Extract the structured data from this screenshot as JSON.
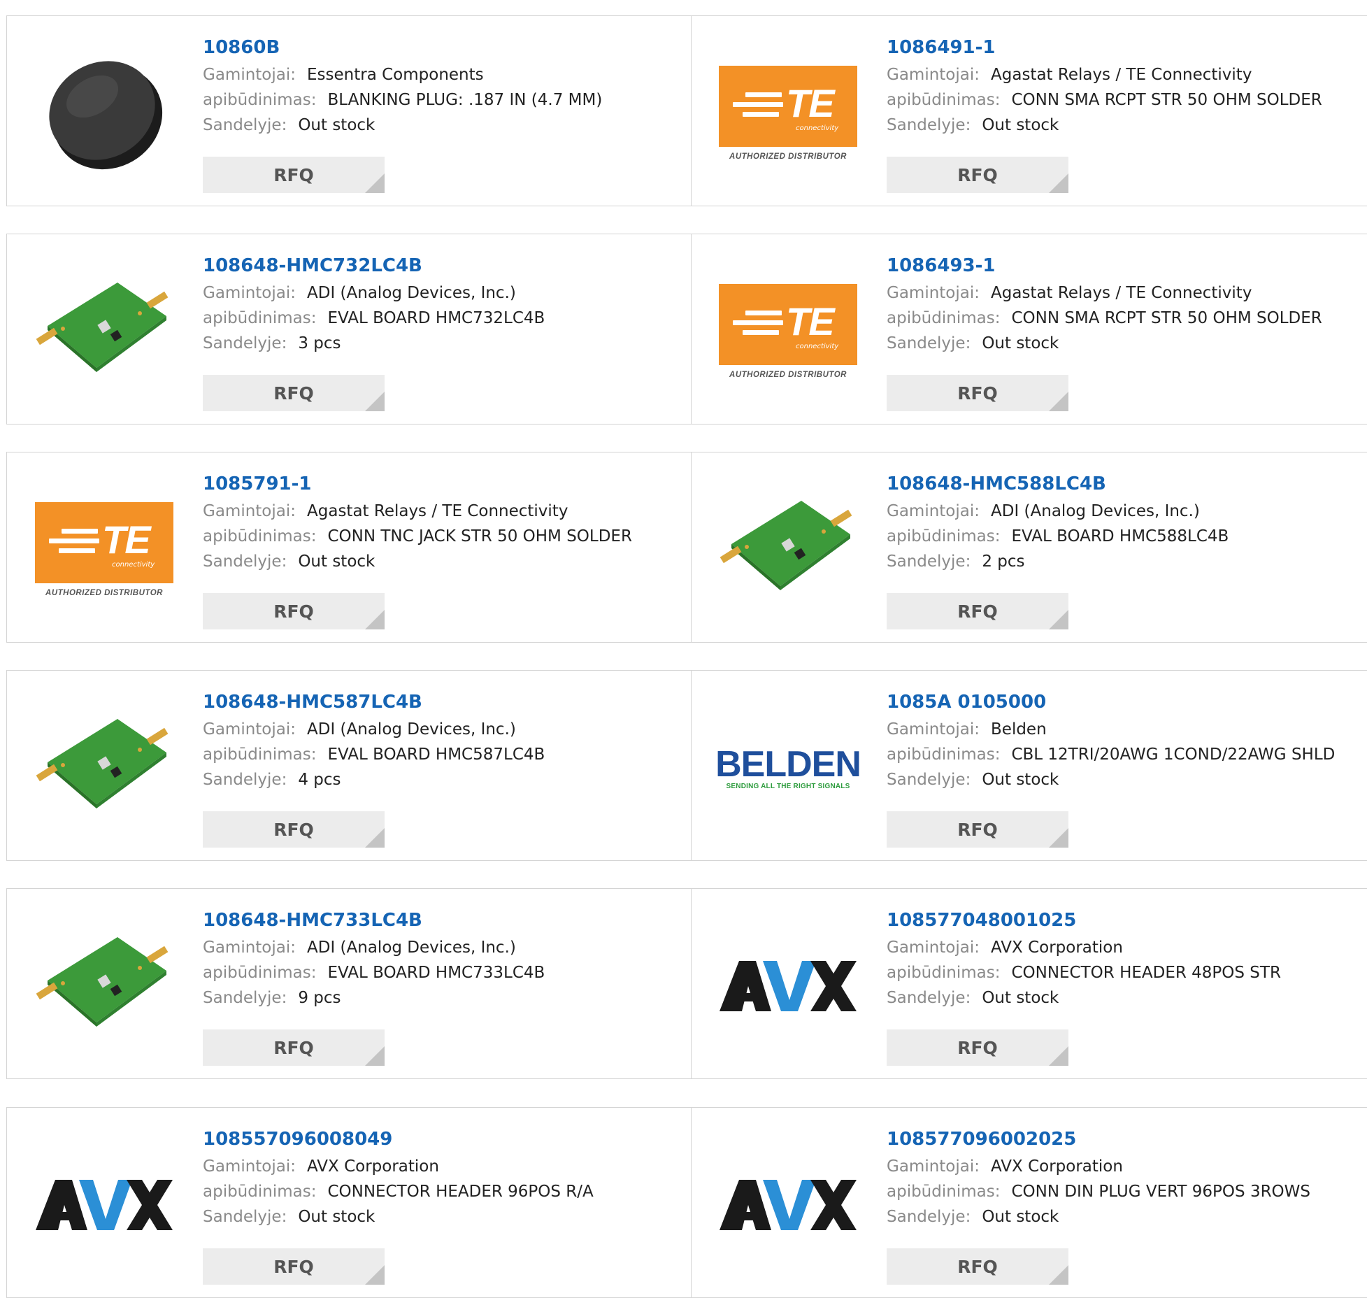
{
  "labels": {
    "manufacturer": "Gamintojai:",
    "description": "apibūdinimas:",
    "stock": "Sandelyje:",
    "rfq": "RFQ"
  },
  "logos": {
    "te_sub": "connectivity",
    "te_auth": "AUTHORIZED DISTRIBUTOR",
    "te_letters": "TE",
    "belden_name": "BELDEN",
    "belden_tag": "SENDING ALL THE RIGHT SIGNALS"
  },
  "products": [
    {
      "part": "10860B",
      "manufacturer": "Essentra Components",
      "description": "BLANKING PLUG: .187 IN (4.7 MM)",
      "stock": "Out stock",
      "image": "blanking-plug"
    },
    {
      "part": "1086491-1",
      "manufacturer": "Agastat Relays / TE Connectivity",
      "description": "CONN SMA RCPT STR 50 OHM SOLDER",
      "stock": "Out stock",
      "image": "te-logo"
    },
    {
      "part": "108648-HMC732LC4B",
      "manufacturer": "ADI (Analog Devices, Inc.)",
      "description": "EVAL BOARD HMC732LC4B",
      "stock": "3 pcs",
      "image": "eval-board"
    },
    {
      "part": "1086493-1",
      "manufacturer": "Agastat Relays / TE Connectivity",
      "description": "CONN SMA RCPT STR 50 OHM SOLDER",
      "stock": "Out stock",
      "image": "te-logo"
    },
    {
      "part": "1085791-1",
      "manufacturer": "Agastat Relays / TE Connectivity",
      "description": "CONN TNC JACK STR 50 OHM SOLDER",
      "stock": "Out stock",
      "image": "te-logo"
    },
    {
      "part": "108648-HMC588LC4B",
      "manufacturer": "ADI (Analog Devices, Inc.)",
      "description": "EVAL BOARD HMC588LC4B",
      "stock": "2 pcs",
      "image": "eval-board"
    },
    {
      "part": "108648-HMC587LC4B",
      "manufacturer": "ADI (Analog Devices, Inc.)",
      "description": "EVAL BOARD HMC587LC4B",
      "stock": "4 pcs",
      "image": "eval-board"
    },
    {
      "part": "1085A 0105000",
      "manufacturer": "Belden",
      "description": "CBL 12TRI/20AWG 1COND/22AWG SHLD",
      "stock": "Out stock",
      "image": "belden-logo"
    },
    {
      "part": "108648-HMC733LC4B",
      "manufacturer": "ADI (Analog Devices, Inc.)",
      "description": "EVAL BOARD HMC733LC4B",
      "stock": "9 pcs",
      "image": "eval-board"
    },
    {
      "part": "108577048001025",
      "manufacturer": "AVX Corporation",
      "description": "CONNECTOR HEADER 48POS STR",
      "stock": "Out stock",
      "image": "avx-logo"
    },
    {
      "part": "108557096008049",
      "manufacturer": "AVX Corporation",
      "description": "CONNECTOR HEADER 96POS R/A",
      "stock": "Out stock",
      "image": "avx-logo"
    },
    {
      "part": "108577096002025",
      "manufacturer": "AVX Corporation",
      "description": "CONN DIN PLUG VERT 96POS 3ROWS",
      "stock": "Out stock",
      "image": "avx-logo"
    }
  ]
}
